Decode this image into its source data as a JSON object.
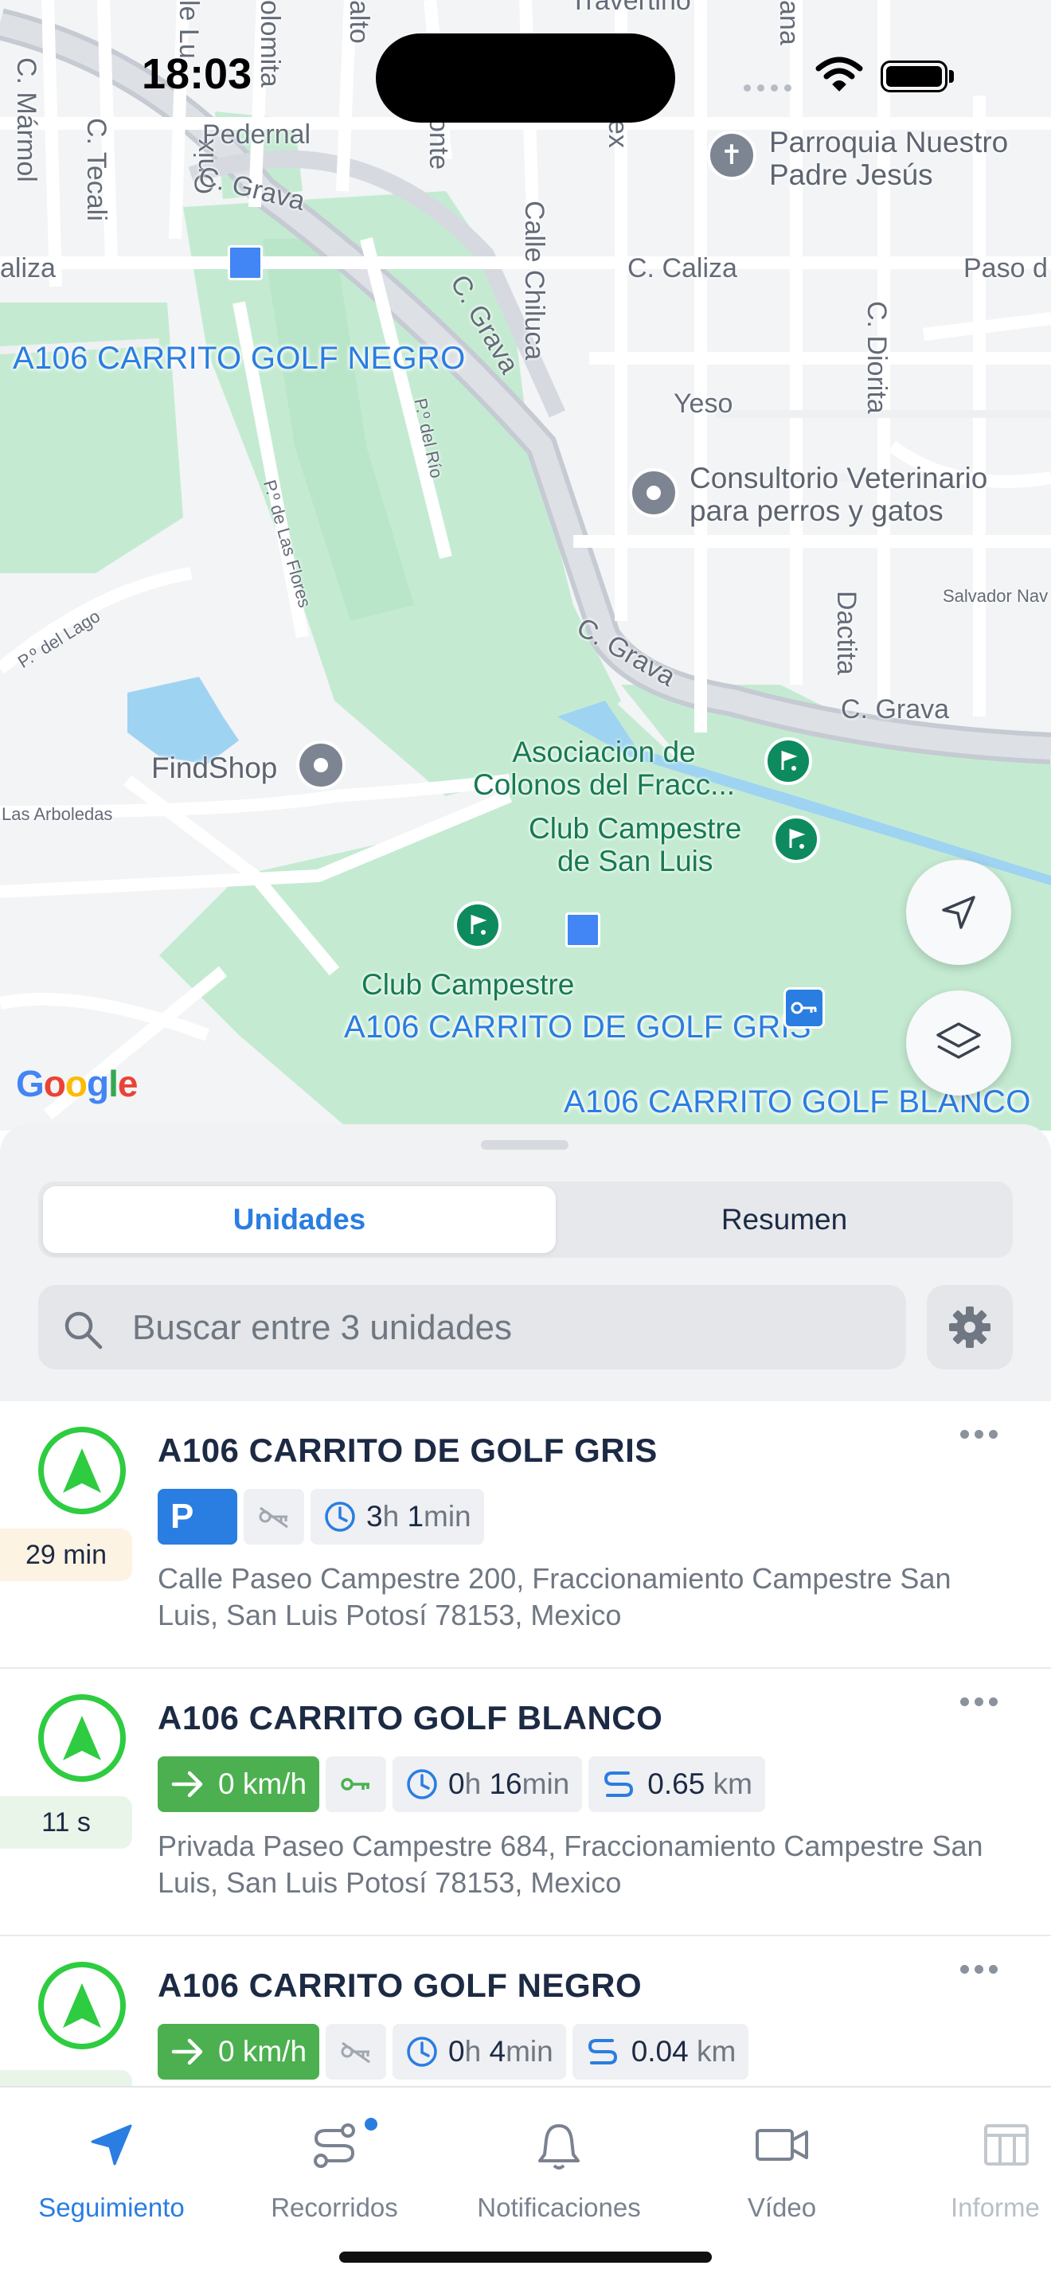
{
  "status_bar": {
    "time": "18:03"
  },
  "map": {
    "streets": [
      "C. Mármol",
      "C. Tecali",
      "Onix",
      "Pedernal",
      "C. Grava",
      "aliza",
      "Calle Chiluca",
      "C. Caliza",
      "Paso d",
      "C. Diorita",
      "Yeso",
      "P.º del Río",
      "P.º de Las Flores",
      "P.º del Lago",
      "C. Grava",
      "Dactita",
      "Salvador Nav",
      "C. Grava",
      "Las Arboledas",
      "olomita",
      "alto",
      "zonte",
      "ex",
      "ana",
      "Travertino",
      "le Lu"
    ],
    "pois": {
      "parroquia": "Parroquia Nuestro\nPadre Jesús",
      "veterinario": "Consultorio Veterinario\npara perros y gatos",
      "findshop": "FindShop",
      "asociacion": "Asociacion de\nColonos del Fracc...",
      "club1": "Club Campestre\nde San Luis",
      "club2": "Club Campestre"
    },
    "unit_labels": {
      "negro": "A106 CARRITO GOLF NEGRO",
      "gris": "A106 CARRITO DE GOLF GRIS",
      "blanco": "A106 CARRITO GOLF BLANCO"
    },
    "google_logo": "Google"
  },
  "tabs": {
    "active": "Unidades",
    "inactive": "Resumen"
  },
  "search": {
    "placeholder": "Buscar entre 3 unidades"
  },
  "units": [
    {
      "name": "A106 CARRITO DE GOLF GRIS",
      "elapsed": "29 min",
      "status": "P",
      "duration_h": "3",
      "duration_h_unit": "h",
      "duration_m": "1",
      "duration_m_unit": "min",
      "address": "Calle Paseo Campestre 200, Fraccionamiento Campestre San Luis, San Luis Potosí 78153, Mexico"
    },
    {
      "name": "A106 CARRITO GOLF BLANCO",
      "elapsed": "11 s",
      "speed": "0 km/h",
      "duration_h": "0",
      "duration_h_unit": "h",
      "duration_m": "16",
      "duration_m_unit": "min",
      "distance": "0.65",
      "distance_unit": "km",
      "address": "Privada Paseo Campestre 684, Fraccionamiento Campestre San Luis, San Luis Potosí 78153, Mexico"
    },
    {
      "name": "A106 CARRITO GOLF NEGRO",
      "speed": "0 km/h",
      "duration_h": "0",
      "duration_h_unit": "h",
      "duration_m": "4",
      "duration_m_unit": "min",
      "distance": "0.04",
      "distance_unit": "km"
    }
  ],
  "tabbar": [
    {
      "label": "Seguimiento",
      "icon": "navigation-arrow-icon"
    },
    {
      "label": "Recorridos",
      "icon": "route-icon"
    },
    {
      "label": "Notificaciones",
      "icon": "bell-icon"
    },
    {
      "label": "Vídeo",
      "icon": "video-camera-icon"
    },
    {
      "label": "Informe",
      "icon": "report-table-icon"
    }
  ],
  "colors": {
    "accent": "#2a7de1",
    "moving": "#4cb050",
    "parked": "#2a7de1",
    "map_green": "#bfe8cf"
  }
}
